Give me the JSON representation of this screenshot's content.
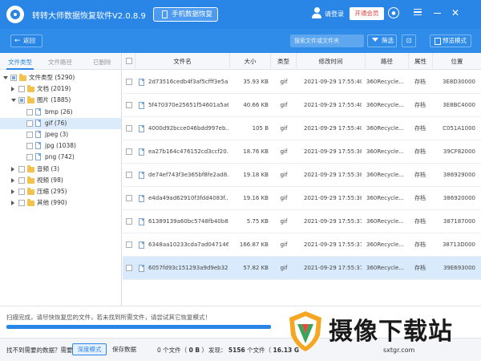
{
  "titlebar": {
    "app_title": "转转大师数据恢复软件V2.0.8.9",
    "phone_recovery": "手机数据恢复",
    "login": "请登录",
    "vip": "开通会员"
  },
  "toolbar": {
    "back": "返回",
    "search_placeholder": "搜索文件或文件夹",
    "filter": "筛选",
    "preview_mode": "预览模式"
  },
  "left_tabs": {
    "file_type": "文件类型",
    "file_path": "文件路径",
    "deleted": "已删除"
  },
  "tree": [
    {
      "label": "文件类型 (5290)",
      "level": 0,
      "expanded": true,
      "folder": true
    },
    {
      "label": "文档 (2019)",
      "level": 1,
      "expanded": false,
      "folder": true
    },
    {
      "label": "图片 (1885)",
      "level": 1,
      "expanded": true,
      "folder": true
    },
    {
      "label": "bmp (26)",
      "level": 2,
      "folder": false
    },
    {
      "label": "gif (76)",
      "level": 2,
      "folder": false,
      "selected": true
    },
    {
      "label": "jpeg (3)",
      "level": 2,
      "folder": false
    },
    {
      "label": "jpg (1038)",
      "level": 2,
      "folder": false
    },
    {
      "label": "png (742)",
      "level": 2,
      "folder": false
    },
    {
      "label": "音频 (3)",
      "level": 1,
      "expanded": false,
      "folder": true
    },
    {
      "label": "视频 (98)",
      "level": 1,
      "expanded": false,
      "folder": true
    },
    {
      "label": "压缩 (295)",
      "level": 1,
      "expanded": false,
      "folder": true
    },
    {
      "label": "其他 (990)",
      "level": 1,
      "expanded": false,
      "folder": true
    }
  ],
  "table": {
    "headers": {
      "name": "文件名",
      "size": "大小",
      "type": "类型",
      "modified": "修改时间",
      "path": "路径",
      "attr": "属性",
      "position": "位置"
    },
    "rows": [
      {
        "name": "2d73516cedb4f3af5cfff3e5a...",
        "size": "35.93 KB",
        "type": "gif",
        "date": "2021-09-29 17:55:40",
        "path": "360Recycle...",
        "attr": "存档",
        "pos": "3E8D30000"
      },
      {
        "name": "5f470370e25651f54601a5a6...",
        "size": "40.66 KB",
        "type": "gif",
        "date": "2021-09-29 17:55:40",
        "path": "360Recycle...",
        "attr": "存档",
        "pos": "3E8BC4000"
      },
      {
        "name": "4000d92bcce046bdd997eb...",
        "size": "105 B",
        "type": "gif",
        "date": "2021-09-29 17:55:40",
        "path": "360Recycle...",
        "attr": "存档",
        "pos": "C051A1000"
      },
      {
        "name": "ea27b164c476152cd3ccf20...",
        "size": "18.76 KB",
        "type": "gif",
        "date": "2021-09-29 17:55:38",
        "path": "360Recycle...",
        "attr": "存档",
        "pos": "39CF82000"
      },
      {
        "name": "de74ef743f3e365bf8fe2ad8...",
        "size": "19.18 KB",
        "type": "gif",
        "date": "2021-09-29 17:55:38",
        "path": "360Recycle...",
        "attr": "存档",
        "pos": "386929000"
      },
      {
        "name": "e4da49ad62910f3fdd4083f...",
        "size": "19.16 KB",
        "type": "gif",
        "date": "2021-09-29 17:55:38",
        "path": "360Recycle...",
        "attr": "存档",
        "pos": "386920000"
      },
      {
        "name": "61389139a60bc5748fb40b8...",
        "size": "5.75 KB",
        "type": "gif",
        "date": "2021-09-29 17:55:37",
        "path": "360Recycle...",
        "attr": "存档",
        "pos": "387187000"
      },
      {
        "name": "6348aa10233cda7ad047146...",
        "size": "166.87 KB",
        "type": "gif",
        "date": "2021-09-29 17:55:37",
        "path": "360Recycle...",
        "attr": "存档",
        "pos": "38713D000"
      },
      {
        "name": "6057fd93c151293a9d9eb32...",
        "size": "57.82 KB",
        "type": "gif",
        "date": "2021-09-29 17:55:37",
        "path": "360Recycle...",
        "attr": "存档",
        "pos": "39E693000",
        "selected": true
      }
    ]
  },
  "status": {
    "message": "扫描完成，请尽快恢复您的文件，若未找到所需文件，请尝试其它恢复模式！",
    "progress": 1.0
  },
  "bottom": {
    "not_found": "找不到需要的数据？需要",
    "deep_mode": "深度模式",
    "save_data": "保存数据",
    "selected_prefix": "0",
    "selected_unit": "个文件（",
    "selected_size": "0 B",
    "selected_suffix": "）",
    "found_prefix": "发现：",
    "found_count": "5156",
    "found_mid": "个文件（",
    "found_size": "16.13 G"
  },
  "watermark": {
    "text": "摄像下载站",
    "url": "sxtgr.com"
  },
  "colors": {
    "titlebar": "#2a86e6",
    "toolbar": "#2f8de9",
    "selected_row": "#d9eafc",
    "accent": "#2a86e6"
  }
}
